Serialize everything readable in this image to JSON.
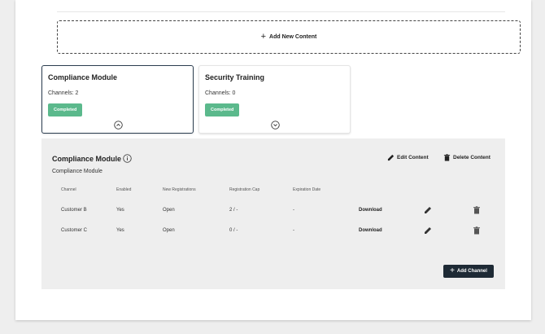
{
  "top_text": "... ... ... ...",
  "add_content": {
    "label": "Add New Content"
  },
  "cards": [
    {
      "title": "Compliance Module",
      "channels": "Channels: 2",
      "status": "Completed",
      "selected": true
    },
    {
      "title": "Security Training",
      "channels": "Channels: 0",
      "status": "Completed",
      "selected": false
    }
  ],
  "panel": {
    "title": "Compliance Module",
    "subtitle": "Compliance Module",
    "edit_label": "Edit Content",
    "delete_label": "Delete Content",
    "columns": [
      "Channel",
      "Enabled",
      "New Registrations",
      "Registration Cap",
      "Expiration Date"
    ],
    "rows": [
      {
        "channel": "Customer B",
        "enabled": "Yes",
        "registrations": "Open",
        "cap": "2 / -",
        "expiration": "-",
        "download": "Download"
      },
      {
        "channel": "Customer C",
        "enabled": "Yes",
        "registrations": "Open",
        "cap": "0 / -",
        "expiration": "-",
        "download": "Download"
      }
    ],
    "add_channel_label": "Add Channel"
  },
  "colors": {
    "badge": "#5bb98c",
    "button_dark": "#1e2a35",
    "panel_bg": "#eeeeee"
  },
  "icons": [
    "plus-icon",
    "chevron-up-icon",
    "chevron-down-icon",
    "info-icon",
    "pencil-icon",
    "trash-icon"
  ]
}
